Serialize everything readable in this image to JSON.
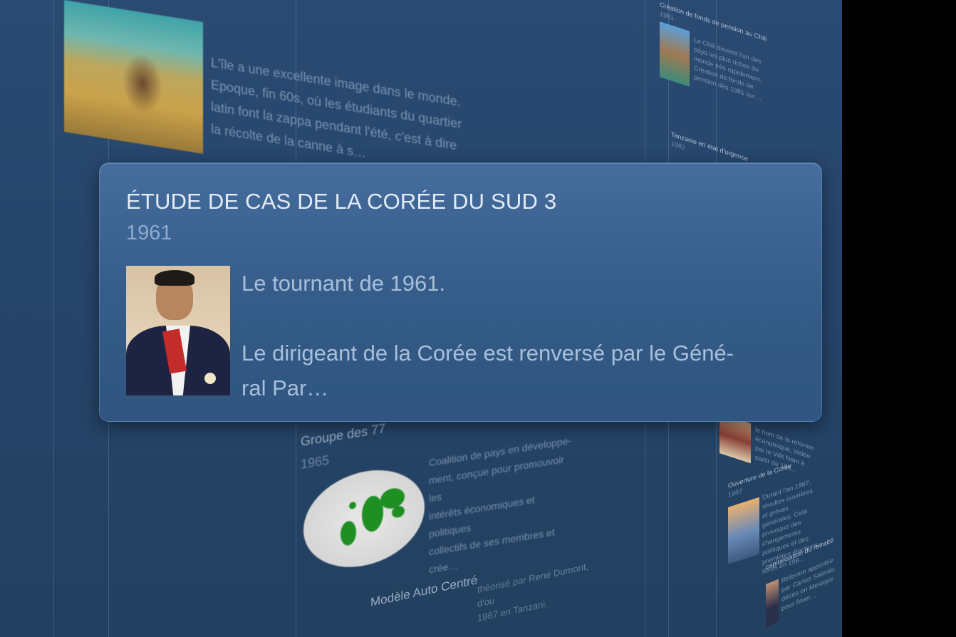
{
  "popup": {
    "title": "ÉTUDE DE CAS DE LA CORÉE DU SUD 3",
    "year": "1961",
    "image_icon": "portrait-photo",
    "line1": "Le tournant de 1961.",
    "line2a": "Le dirigeant de la Corée est renversé par le Géné-",
    "line2b": "ral Par…"
  },
  "background": {
    "haiti": {
      "text_lines": [
        "L'île a une excellente image dans le monde.",
        "Epoque, fin 60s, où les étudiants du quartier",
        "latin font la zappa pendant l'été, c'est à dire",
        "la récolte de la canne à s…"
      ]
    },
    "g77": {
      "title": "Groupe des 77",
      "year": "1965",
      "text_lines": [
        "Coalition de pays en développe-",
        "ment, conçue pour promouvoir les",
        "intérêts économiques et politiques",
        "collectifs de ses membres et crée…"
      ]
    },
    "auto": {
      "title": "Modèle Auto Centré",
      "text_lines": [
        "théorisé par René Dumont, d'ou",
        "1967 en Tanzani."
      ]
    },
    "side": {
      "chili_title": "Création de fonds de pension au Chili",
      "chili_year": "1981",
      "chili_text": "Le Chili devient l'un des pays les plus riches du monde très rapidement.",
      "chili_text2": "Création de fonds de pension dès 1981 sur…",
      "tanz_title": "Tanzanie en état d'urgence",
      "tanz_year": "1982",
      "mid_text": "le nom de la réforme économique, initiée par le Viêt Nam à partir de 198…",
      "coree_title": "Ouverture de la Corée",
      "coree_year": "1987",
      "coree_text": "Durant l'an 1987, révoltes ouvrières et grèves générales. Cela provoque des changements politiques et des premières élections libres en 198…",
      "cap_title": "capitalisation du retraité",
      "cap_text": "Réforme apportée par Carlos Salinas, décès en Mexique pour finan…"
    }
  },
  "colors": {
    "stage_bg": "#26456b",
    "popup_bg": "#3a618f",
    "popup_title": "#e3ebf6"
  }
}
